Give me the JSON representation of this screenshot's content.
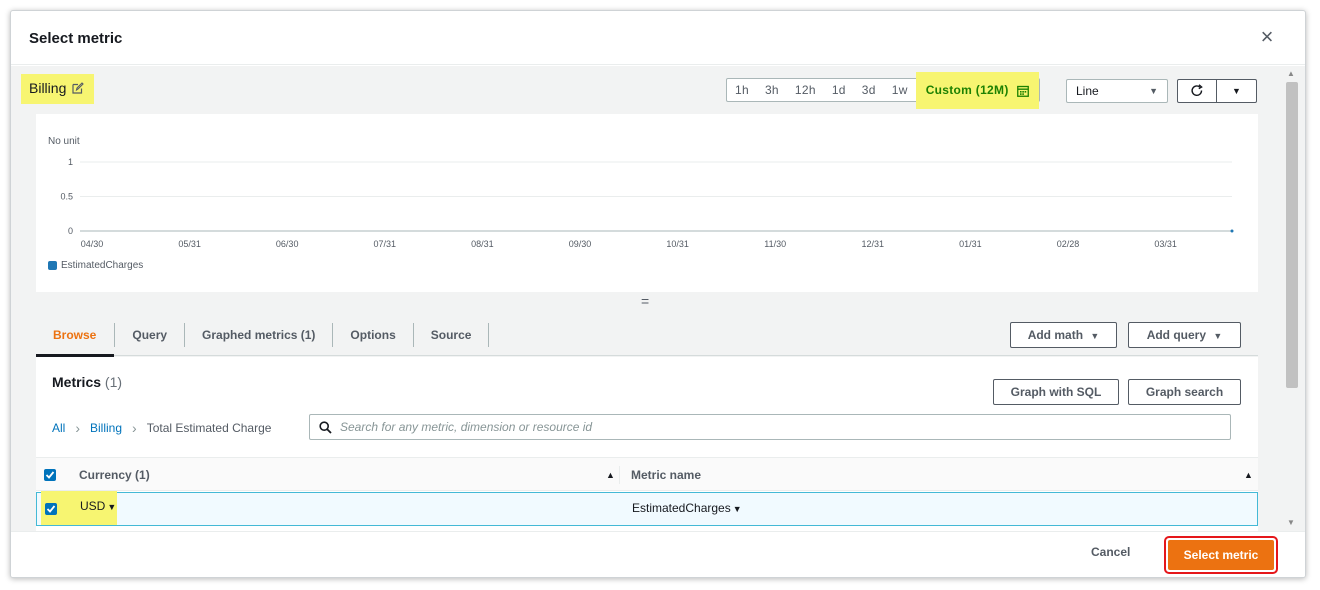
{
  "modal": {
    "title": "Select metric",
    "close_label": "×"
  },
  "graph": {
    "title": "Billing",
    "time_ranges": [
      "1h",
      "3h",
      "12h",
      "1d",
      "3d",
      "1w"
    ],
    "custom_range": "Custom (12M)",
    "chart_type": "Line",
    "icons": [
      "edit-icon",
      "calendar-icon",
      "refresh-icon",
      "chevron-down-icon"
    ],
    "resize_handle": "="
  },
  "chart_data": {
    "type": "line",
    "ylabel": "No unit",
    "yticks": [
      "1",
      "0.5",
      "0"
    ],
    "ylim": [
      0,
      1
    ],
    "categories": [
      "04/30",
      "05/31",
      "06/30",
      "07/31",
      "08/31",
      "09/30",
      "10/31",
      "11/30",
      "12/31",
      "01/31",
      "02/28",
      "03/31"
    ],
    "series": [
      {
        "name": "EstimatedCharges",
        "values": [
          0
        ],
        "color": "#1f77b4"
      }
    ],
    "grid": true,
    "legend": "bottom-left"
  },
  "tabs": [
    {
      "label": "Browse",
      "active": true
    },
    {
      "label": "Query",
      "active": false
    },
    {
      "label": "Graphed metrics (1)",
      "active": false
    },
    {
      "label": "Options",
      "active": false
    },
    {
      "label": "Source",
      "active": false
    }
  ],
  "toolbar": {
    "add_math": "Add math",
    "add_query": "Add query",
    "graph_with_sql": "Graph with SQL",
    "graph_search": "Graph search"
  },
  "metrics": {
    "title": "Metrics",
    "count": "(1)",
    "breadcrumb": {
      "all": "All",
      "billing": "Billing",
      "current": "Total Estimated Charge"
    },
    "search_placeholder": "Search for any metric, dimension or resource id",
    "columns": {
      "currency": "Currency (1)",
      "metric_name": "Metric name"
    },
    "rows": [
      {
        "currency": "USD",
        "metric_name": "EstimatedCharges",
        "checked": true
      }
    ]
  },
  "footer": {
    "cancel": "Cancel",
    "select_metric": "Select metric"
  },
  "colors": {
    "accent_orange": "#ec7211",
    "link_blue": "#0073bb",
    "highlight_yellow": "#f7f571",
    "custom_range_green": "#1d8102",
    "callout_red": "#e5171b"
  }
}
